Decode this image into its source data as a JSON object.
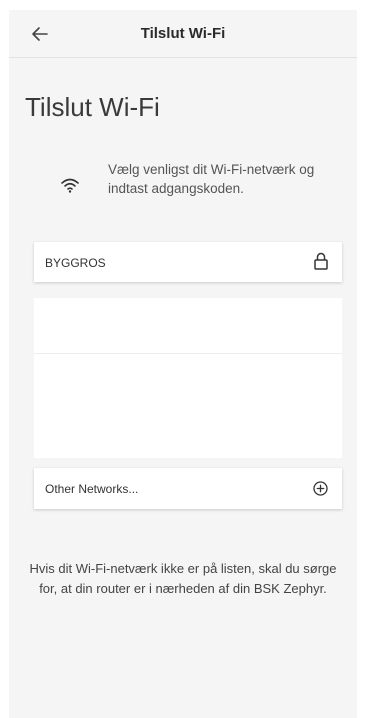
{
  "header": {
    "back_icon": "arrow-left-icon",
    "title": "Tilslut Wi-Fi"
  },
  "main": {
    "title": "Tilslut Wi-Fi",
    "intro_icon": "wifi-icon",
    "intro_text": "Vælg venligst dit Wi-Fi-netværk og indtast adgangskoden."
  },
  "networks": [
    {
      "name": "BYGGROS",
      "secured": true,
      "icon": "lock-icon"
    }
  ],
  "other_networks": {
    "label": "Other Networks...",
    "icon": "plus-circle-icon"
  },
  "footer": {
    "note": "Hvis dit Wi-Fi-netværk ikke er på listen, skal du sørge for, at din router er i nærheden af din BSK Zephyr."
  }
}
